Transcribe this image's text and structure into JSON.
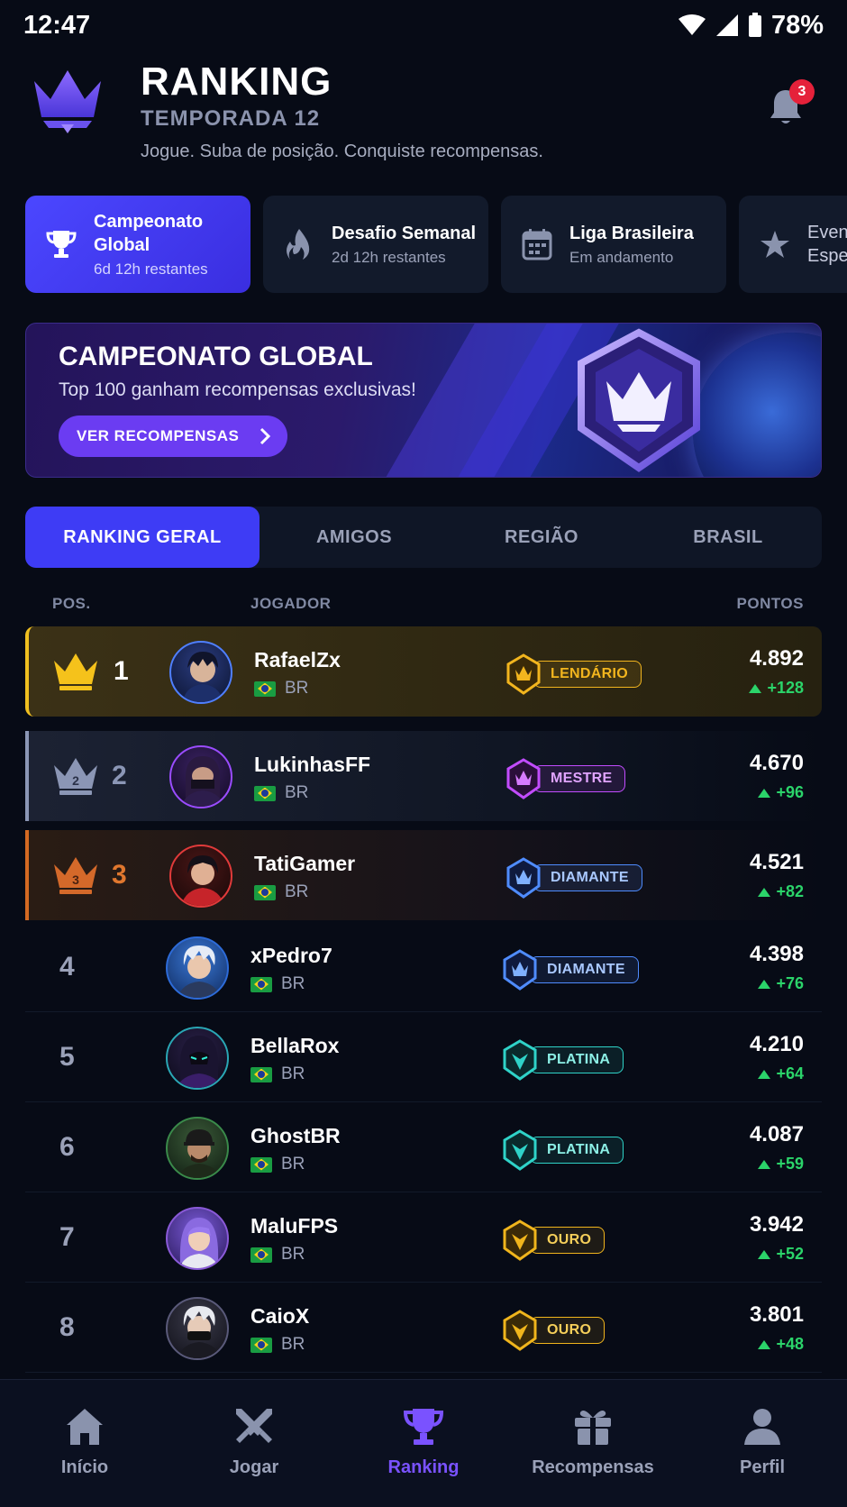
{
  "status": {
    "time": "12:47",
    "battery": "78%"
  },
  "header": {
    "title": "RANKING",
    "season": "TEMPORADA 12",
    "tagline": "Jogue. Suba de posição. Conquiste recompensas.",
    "notifications": "3"
  },
  "events": [
    {
      "name_line1": "Campeonato",
      "name_line2": "Global",
      "sub": "6d 12h restantes",
      "icon": "trophy-icon"
    },
    {
      "name_line1": "Desafio Semanal",
      "name_line2": "",
      "sub": "2d 12h restantes",
      "icon": "flame-icon"
    },
    {
      "name_line1": "Liga Brasileira",
      "name_line2": "",
      "sub": "Em andamento",
      "icon": "calendar-icon"
    },
    {
      "name_line1": "Even",
      "name_line2": "Espe",
      "sub": "",
      "icon": "star-icon"
    }
  ],
  "banner": {
    "title": "CAMPEONATO GLOBAL",
    "subtitle": "Top 100 ganham recompensas exclusivas!",
    "button": "VER RECOMPENSAS"
  },
  "tabs": [
    "RANKING GERAL",
    "AMIGOS",
    "REGIÃO",
    "BRASIL"
  ],
  "table_header": {
    "pos": "POS.",
    "player": "JOGADOR",
    "points": "PONTOS"
  },
  "players": [
    {
      "pos": "1",
      "name": "RafaelZx",
      "country": "BR",
      "tier": "LENDÁRIO",
      "points": "4.892",
      "delta": "+128"
    },
    {
      "pos": "2",
      "name": "LukinhasFF",
      "country": "BR",
      "tier": "MESTRE",
      "points": "4.670",
      "delta": "+96"
    },
    {
      "pos": "3",
      "name": "TatiGamer",
      "country": "BR",
      "tier": "DIAMANTE",
      "points": "4.521",
      "delta": "+82"
    },
    {
      "pos": "4",
      "name": "xPedro7",
      "country": "BR",
      "tier": "DIAMANTE",
      "points": "4.398",
      "delta": "+76"
    },
    {
      "pos": "5",
      "name": "BellaRox",
      "country": "BR",
      "tier": "PLATINA",
      "points": "4.210",
      "delta": "+64"
    },
    {
      "pos": "6",
      "name": "GhostBR",
      "country": "BR",
      "tier": "PLATINA",
      "points": "4.087",
      "delta": "+59"
    },
    {
      "pos": "7",
      "name": "MaluFPS",
      "country": "BR",
      "tier": "OURO",
      "points": "3.942",
      "delta": "+52"
    },
    {
      "pos": "8",
      "name": "CaioX",
      "country": "BR",
      "tier": "OURO",
      "points": "3.801",
      "delta": "+48"
    }
  ],
  "tier_colors": {
    "LENDÁRIO": "#f2b51e",
    "MESTRE": "#c24cff",
    "DIAMANTE": "#4f8cff",
    "PLATINA": "#2fd3c8",
    "OURO": "#f0b51c"
  },
  "nav": [
    {
      "label": "Início",
      "icon": "home-icon"
    },
    {
      "label": "Jogar",
      "icon": "swords-icon"
    },
    {
      "label": "Ranking",
      "icon": "trophy-icon"
    },
    {
      "label": "Recompensas",
      "icon": "gift-icon"
    },
    {
      "label": "Perfil",
      "icon": "user-icon"
    }
  ],
  "colors": {
    "accent": "#3e3cf5",
    "nav_active": "#7a52ff",
    "positive": "#2bd46a"
  }
}
